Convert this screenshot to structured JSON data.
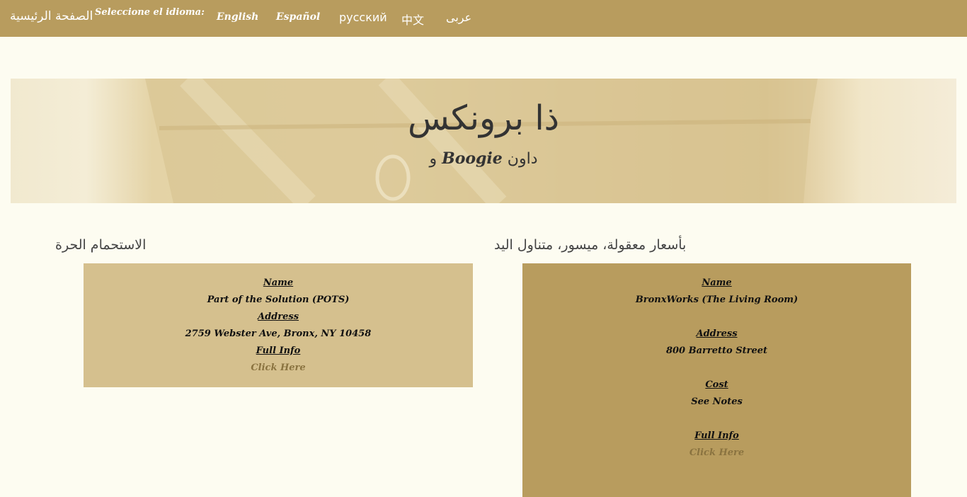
{
  "nav": {
    "home": "الصفحة الرئيسية",
    "language_label": "Seleccione el idioma:",
    "languages": [
      "English",
      "Español",
      "русский",
      "中文",
      "عربى"
    ]
  },
  "hero": {
    "title": "ذا برونكس",
    "subtitle_prefix": "داون",
    "subtitle_name": "Boogie",
    "subtitle_suffix": "و"
  },
  "columns": {
    "left_heading": "الاستحمام الحرة",
    "right_heading": "بأسعار معقولة، ميسور، متناول اليد"
  },
  "cards": {
    "left": {
      "name_label": "Name",
      "name": "Part of the Solution (POTS)",
      "address_label": "Address",
      "address": "2759 Webster Ave, Bronx, NY 10458",
      "info_label": "Full Info",
      "link": "Click Here"
    },
    "right": {
      "name_label": "Name",
      "name": "BronxWorks (The Living Room)",
      "address_label": "Address",
      "address": "800 Barretto Street",
      "cost_label": "Cost",
      "cost": "See Notes",
      "info_label": "Full Info",
      "link": "Click Here"
    }
  },
  "colors": {
    "nav_bg": "#b89c5e",
    "page_bg": "#fdfcf1",
    "left_card_bg": "#d5c08e",
    "right_card_bg": "#b89c5e",
    "link": "#8a7340"
  }
}
